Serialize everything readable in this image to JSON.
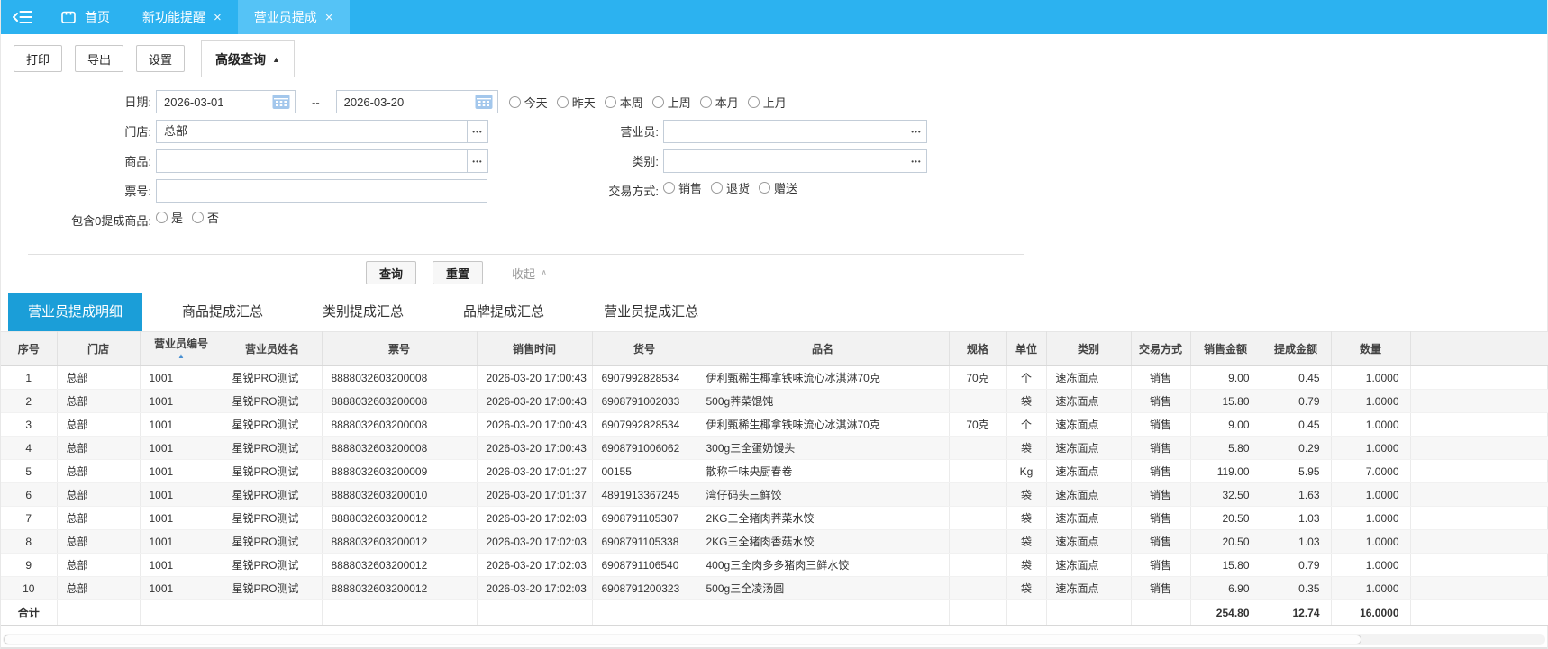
{
  "topbar": {
    "home_label": "首页",
    "tabs": [
      {
        "label": "新功能提醒",
        "active": false
      },
      {
        "label": "营业员提成",
        "active": true
      }
    ]
  },
  "icons": {
    "close": "×",
    "caret_up": "▲",
    "collapse_caret": "∧",
    "ellipsis": "•••",
    "sort_asc": "▲"
  },
  "toolbar": {
    "print_label": "打印",
    "export_label": "导出",
    "settings_label": "设置",
    "advanced_query_label": "高级查询"
  },
  "filters": {
    "date_label": "日期:",
    "date_from": "2026-03-01",
    "date_to": "2026-03-20",
    "date_separator": "--",
    "date_quick_options": [
      "今天",
      "昨天",
      "本周",
      "上周",
      "本月",
      "上月"
    ],
    "store_label": "门店:",
    "store_value": "总部",
    "clerk_label": "营业员:",
    "clerk_value": "",
    "product_label": "商品:",
    "product_value": "",
    "category_label": "类别:",
    "category_value": "",
    "ticket_label": "票号:",
    "ticket_value": "",
    "trade_type_label": "交易方式:",
    "trade_type_options": [
      "销售",
      "退货",
      "赠送"
    ],
    "zero_commission_label": "包含0提成商品:",
    "zero_commission_options": [
      "是",
      "否"
    ]
  },
  "actions": {
    "query_label": "查询",
    "reset_label": "重置",
    "collapse_label": "收起"
  },
  "subtabs": [
    {
      "label": "营业员提成明细",
      "active": true
    },
    {
      "label": "商品提成汇总",
      "active": false
    },
    {
      "label": "类别提成汇总",
      "active": false
    },
    {
      "label": "品牌提成汇总",
      "active": false
    },
    {
      "label": "营业员提成汇总",
      "active": false
    }
  ],
  "table": {
    "columns": [
      "序号",
      "门店",
      "营业员编号",
      "营业员姓名",
      "票号",
      "销售时间",
      "货号",
      "品名",
      "规格",
      "单位",
      "类别",
      "交易方式",
      "销售金额",
      "提成金额",
      "数量"
    ],
    "sorted_column": "营业员编号",
    "rows": [
      [
        "1",
        "总部",
        "1001",
        "星锐PRO测试",
        "8888032603200008",
        "2026-03-20 17:00:43",
        "6907992828534",
        "伊利甄稀生椰拿铁味流心冰淇淋70克",
        "70克",
        "个",
        "速冻面点",
        "销售",
        "9.00",
        "0.45",
        "1.0000"
      ],
      [
        "2",
        "总部",
        "1001",
        "星锐PRO测试",
        "8888032603200008",
        "2026-03-20 17:00:43",
        "6908791002033",
        "500g荠菜馄饨",
        "",
        "袋",
        "速冻面点",
        "销售",
        "15.80",
        "0.79",
        "1.0000"
      ],
      [
        "3",
        "总部",
        "1001",
        "星锐PRO测试",
        "8888032603200008",
        "2026-03-20 17:00:43",
        "6907992828534",
        "伊利甄稀生椰拿铁味流心冰淇淋70克",
        "70克",
        "个",
        "速冻面点",
        "销售",
        "9.00",
        "0.45",
        "1.0000"
      ],
      [
        "4",
        "总部",
        "1001",
        "星锐PRO测试",
        "8888032603200008",
        "2026-03-20 17:00:43",
        "6908791006062",
        "300g三全蛋奶馒头",
        "",
        "袋",
        "速冻面点",
        "销售",
        "5.80",
        "0.29",
        "1.0000"
      ],
      [
        "5",
        "总部",
        "1001",
        "星锐PRO测试",
        "8888032603200009",
        "2026-03-20 17:01:27",
        "00155",
        "散称千味央厨春卷",
        "",
        "Kg",
        "速冻面点",
        "销售",
        "119.00",
        "5.95",
        "7.0000"
      ],
      [
        "6",
        "总部",
        "1001",
        "星锐PRO测试",
        "8888032603200010",
        "2026-03-20 17:01:37",
        "4891913367245",
        "湾仔码头三鲜饺",
        "",
        "袋",
        "速冻面点",
        "销售",
        "32.50",
        "1.63",
        "1.0000"
      ],
      [
        "7",
        "总部",
        "1001",
        "星锐PRO测试",
        "8888032603200012",
        "2026-03-20 17:02:03",
        "6908791105307",
        "2KG三全猪肉荠菜水饺",
        "",
        "袋",
        "速冻面点",
        "销售",
        "20.50",
        "1.03",
        "1.0000"
      ],
      [
        "8",
        "总部",
        "1001",
        "星锐PRO测试",
        "8888032603200012",
        "2026-03-20 17:02:03",
        "6908791105338",
        "2KG三全猪肉香菇水饺",
        "",
        "袋",
        "速冻面点",
        "销售",
        "20.50",
        "1.03",
        "1.0000"
      ],
      [
        "9",
        "总部",
        "1001",
        "星锐PRO测试",
        "8888032603200012",
        "2026-03-20 17:02:03",
        "6908791106540",
        "400g三全肉多多猪肉三鲜水饺",
        "",
        "袋",
        "速冻面点",
        "销售",
        "15.80",
        "0.79",
        "1.0000"
      ],
      [
        "10",
        "总部",
        "1001",
        "星锐PRO测试",
        "8888032603200012",
        "2026-03-20 17:02:03",
        "6908791200323",
        "500g三全凌汤圆",
        "",
        "袋",
        "速冻面点",
        "销售",
        "6.90",
        "0.35",
        "1.0000"
      ]
    ],
    "total_row": [
      "合计",
      "",
      "",
      "",
      "",
      "",
      "",
      "",
      "",
      "",
      "",
      "",
      "254.80",
      "12.74",
      "16.0000"
    ]
  },
  "colors": {
    "topbar_bg": "#2cb2f0",
    "topbar_tab_active_bg": "#55c3f6",
    "subtab_active_bg": "#1b9ed8",
    "sort_arrow": "#4a90d2",
    "calendar_icon": "#a3c7ec"
  }
}
